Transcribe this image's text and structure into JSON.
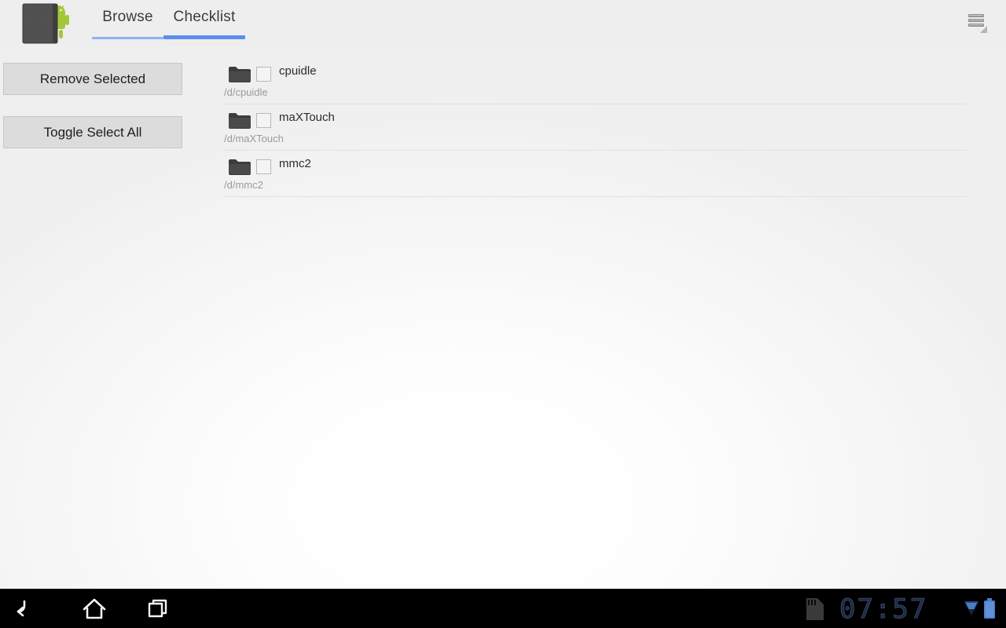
{
  "app": {
    "icon_name": "android-tablet-app-icon",
    "accent_color": "#5b8def",
    "inactive_tab_underline_color": "#8cb4f0"
  },
  "action_bar": {
    "tabs": [
      {
        "label": "Browse",
        "active": false
      },
      {
        "label": "Checklist",
        "active": true
      }
    ],
    "overflow_menu_label": "More options"
  },
  "sidebar": {
    "buttons": [
      {
        "label": "Remove Selected"
      },
      {
        "label": "Toggle Select All"
      }
    ]
  },
  "list": {
    "rows": [
      {
        "title": "cpuidle",
        "path": "/d/cpuidle",
        "checked": false
      },
      {
        "title": "maXTouch",
        "path": "/d/maXTouch",
        "checked": false
      },
      {
        "title": "mmc2",
        "path": "/d/mmc2",
        "checked": false
      }
    ]
  },
  "system_bar": {
    "back_label": "Back",
    "home_label": "Home",
    "recents_label": "Recent apps",
    "sd_label": "SD card",
    "clock": "07:57",
    "signal_label": "Signal",
    "battery_label": "Battery",
    "status_icon_color": "#4a7fc8"
  }
}
